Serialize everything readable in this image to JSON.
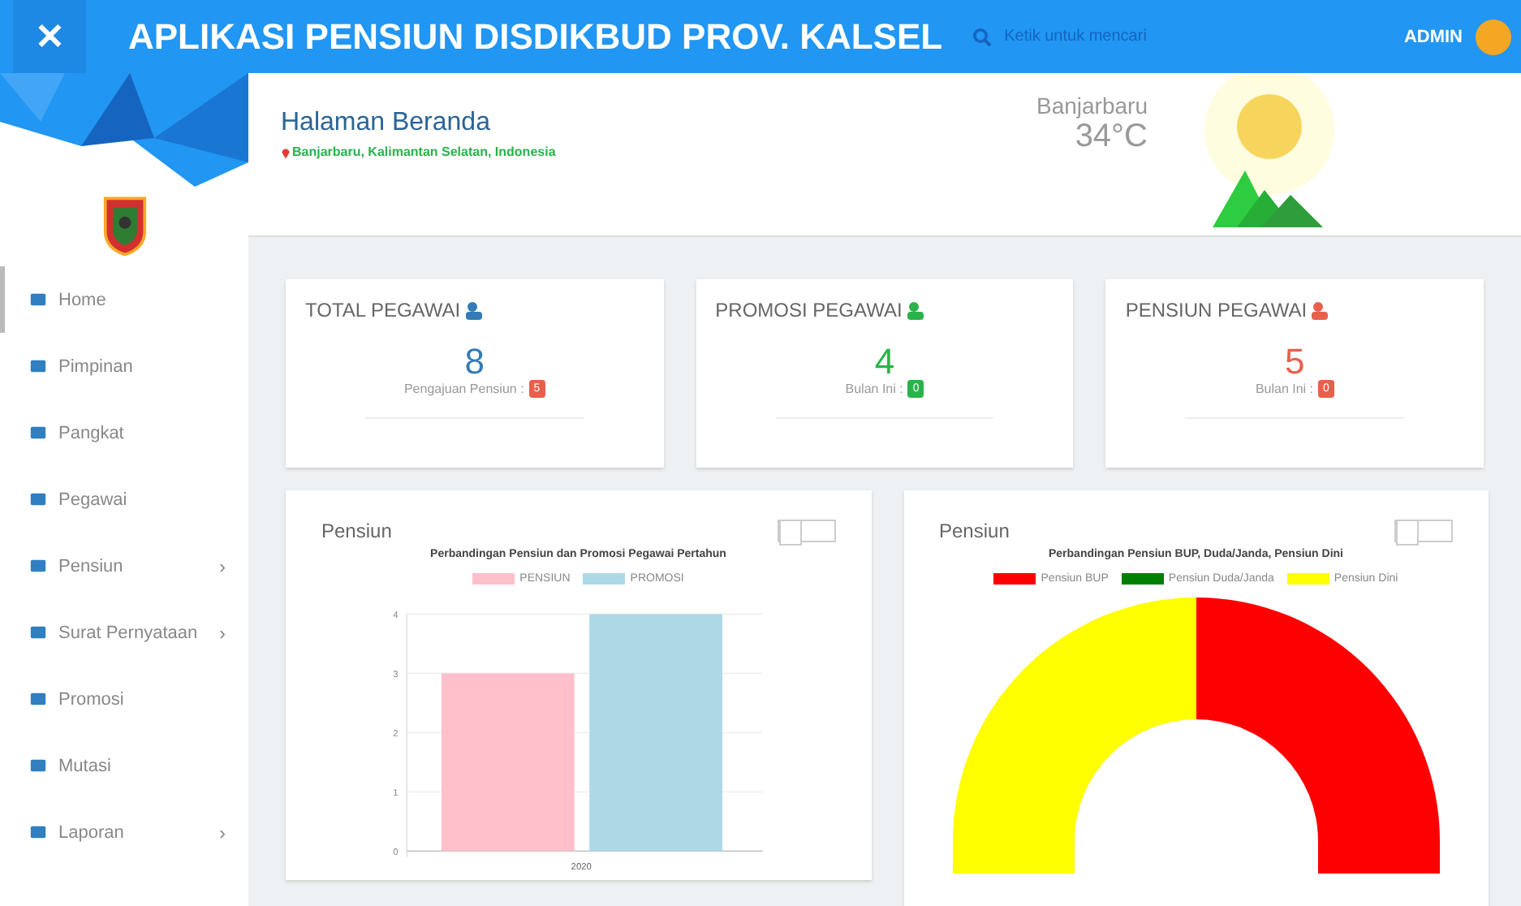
{
  "topbar": {
    "close": "✕",
    "title": "APLIKASI PENSIUN DISDIKBUD PROV. KALSEL",
    "search_placeholder": "Ketik untuk mencari",
    "user": "ADMIN"
  },
  "header": {
    "title": "Halaman Beranda",
    "location": "Banjarbaru, Kalimantan Selatan, Indonesia",
    "weather_city": "Banjarbaru",
    "weather_temp": "34°C"
  },
  "sidebar": {
    "items": [
      {
        "label": "Home",
        "selected": true
      },
      {
        "label": "Pimpinan",
        "selected": false
      },
      {
        "label": "Pangkat",
        "selected": false
      },
      {
        "label": "Pegawai",
        "selected": false
      },
      {
        "label": "Pensiun",
        "selected": false,
        "chevron": "›"
      },
      {
        "label": "Surat Pernyataan",
        "selected": false,
        "chevron": "›"
      },
      {
        "label": "Promosi",
        "selected": false
      },
      {
        "label": "Mutasi",
        "selected": false
      },
      {
        "label": "Laporan",
        "selected": false,
        "chevron": "›"
      }
    ]
  },
  "stats": [
    {
      "title": "TOTAL PEGAWAI",
      "value": "8",
      "color": "#337ab7",
      "caption": "Pengajuan Pensiun :",
      "badge": {
        "text": "5",
        "color": "#e8604c"
      }
    },
    {
      "title": "PROMOSI PEGAWAI",
      "value": "4",
      "color": "#2ab34a",
      "caption": "Bulan Ini :",
      "badge": {
        "text": "0",
        "color": "#2ab34a"
      }
    },
    {
      "title": "PENSIUN PEGAWAI",
      "value": "5",
      "color": "#e8604c",
      "caption": "Bulan Ini :",
      "badge": {
        "text": "0",
        "color": "#e8604c"
      }
    }
  ],
  "bar_panel": {
    "heading": "Pensiun",
    "toggle": {
      "on": false
    },
    "chart_data": {
      "type": "bar",
      "grid": true,
      "title": "Perbandingan Pensiun dan Promosi Pegawai Pertahun",
      "categories": [
        "2020"
      ],
      "series": [
        {
          "name": "PENSIUN",
          "color": "#ffc0cb",
          "values": [
            3
          ]
        },
        {
          "name": "PROMOSI",
          "color": "#add8e6",
          "values": [
            4
          ]
        }
      ],
      "ylim": [
        0,
        4
      ],
      "yticks": [
        0,
        1,
        2,
        3,
        4
      ]
    }
  },
  "donut_panel": {
    "heading": "Pensiun",
    "toggle": {
      "on": false
    },
    "title": "Perbandingan Pensiun BUP, Duda/Janda, Pensiun Dini",
    "legend": [
      {
        "label": "Pensiun BUP",
        "color": "#ff0000"
      },
      {
        "label": "Pensiun Duda/Janda",
        "color": "#008000"
      },
      {
        "label": "Pensiun Dini",
        "color": "#ffff00"
      }
    ]
  }
}
